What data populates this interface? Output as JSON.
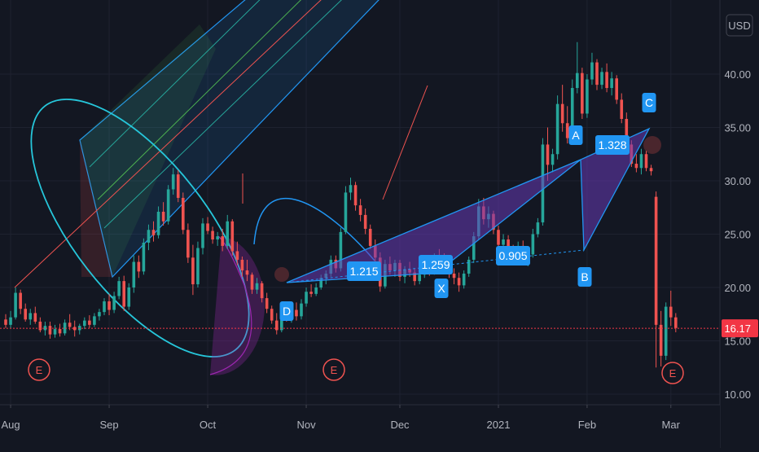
{
  "chart_data": {
    "type": "candlestick",
    "title": "",
    "currency": "USD",
    "last_price": "16.17",
    "y_axis_ticks": [
      "40.00",
      "35.00",
      "30.00",
      "25.00",
      "20.00",
      "15.00",
      "10.00"
    ],
    "x_axis_ticks": [
      "Aug",
      "Sep",
      "Oct",
      "Nov",
      "Dec",
      "2021",
      "Feb",
      "Mar"
    ],
    "ylim": [
      9.5,
      44
    ],
    "grid": true,
    "colors": {
      "up": "#26a69a",
      "down": "#ef5350",
      "price_line": "#f23645",
      "pattern_fill": "#673ab7",
      "pattern_line": "#2196f3",
      "label_bg": "#2196f3"
    },
    "candles": [
      [
        0,
        17.0,
        17.5,
        16.2,
        16.5
      ],
      [
        1,
        16.5,
        17.8,
        16.2,
        17.2
      ],
      [
        2,
        17.2,
        20.0,
        17.0,
        19.5
      ],
      [
        3,
        19.5,
        19.8,
        17.5,
        18.0
      ],
      [
        4,
        18.0,
        18.5,
        16.8,
        17.0
      ],
      [
        5,
        17.0,
        18.0,
        16.5,
        17.6
      ],
      [
        6,
        17.6,
        18.2,
        16.6,
        16.8
      ],
      [
        7,
        16.8,
        17.2,
        15.8,
        16.0
      ],
      [
        8,
        16.0,
        16.8,
        15.5,
        16.4
      ],
      [
        9,
        16.4,
        16.8,
        15.2,
        15.6
      ],
      [
        10,
        15.6,
        16.5,
        15.3,
        16.1
      ],
      [
        11,
        16.1,
        16.6,
        15.4,
        15.7
      ],
      [
        12,
        15.7,
        17.0,
        15.5,
        16.7
      ],
      [
        13,
        16.7,
        17.5,
        16.0,
        16.3
      ],
      [
        14,
        16.3,
        16.9,
        15.4,
        16.0
      ],
      [
        15,
        16.0,
        16.6,
        15.6,
        16.4
      ],
      [
        16,
        16.4,
        17.2,
        16.1,
        16.9
      ],
      [
        17,
        16.9,
        17.4,
        16.2,
        16.5
      ],
      [
        18,
        16.5,
        17.6,
        16.3,
        17.3
      ],
      [
        19,
        17.3,
        18.0,
        16.9,
        17.7
      ],
      [
        20,
        17.7,
        19.0,
        17.4,
        18.7
      ],
      [
        21,
        18.7,
        19.4,
        17.4,
        17.9
      ],
      [
        22,
        17.9,
        19.6,
        17.6,
        19.2
      ],
      [
        23,
        19.2,
        21.0,
        18.9,
        20.6
      ],
      [
        24,
        20.6,
        21.1,
        17.8,
        18.2
      ],
      [
        25,
        18.2,
        20.4,
        17.9,
        20.0
      ],
      [
        26,
        20.0,
        23.0,
        19.5,
        22.4
      ],
      [
        27,
        22.4,
        23.0,
        20.9,
        21.5
      ],
      [
        28,
        21.5,
        24.6,
        21.2,
        24.2
      ],
      [
        29,
        24.2,
        25.9,
        23.5,
        25.4
      ],
      [
        30,
        25.4,
        26.2,
        24.3,
        24.9
      ],
      [
        31,
        24.9,
        27.6,
        24.6,
        27.1
      ],
      [
        32,
        27.1,
        28.0,
        25.8,
        26.2
      ],
      [
        33,
        26.2,
        29.6,
        25.9,
        29.2
      ],
      [
        34,
        29.2,
        31.2,
        28.7,
        30.6
      ],
      [
        35,
        30.6,
        31.0,
        28.0,
        28.4
      ],
      [
        36,
        28.4,
        28.9,
        25.0,
        25.4
      ],
      [
        37,
        25.4,
        26.0,
        22.3,
        22.8
      ],
      [
        38,
        22.8,
        24.0,
        19.3,
        20.3
      ],
      [
        39,
        20.3,
        24.3,
        20.0,
        23.7
      ],
      [
        40,
        23.7,
        26.5,
        23.1,
        26.0
      ],
      [
        41,
        26.0,
        26.6,
        25.0,
        25.3
      ],
      [
        42,
        25.3,
        25.7,
        24.1,
        24.5
      ],
      [
        43,
        24.5,
        25.2,
        23.9,
        24.8
      ],
      [
        44,
        24.8,
        25.5,
        23.4,
        23.9
      ],
      [
        45,
        23.9,
        26.8,
        23.6,
        26.2
      ],
      [
        46,
        26.2,
        26.4,
        23.0,
        23.4
      ],
      [
        47,
        23.4,
        24.3,
        22.1,
        22.6
      ],
      [
        48,
        22.6,
        22.9,
        21.0,
        21.6
      ],
      [
        49,
        21.6,
        22.6,
        20.6,
        21.2
      ],
      [
        50,
        21.2,
        21.4,
        19.4,
        19.8
      ],
      [
        51,
        19.8,
        20.9,
        19.4,
        20.4
      ],
      [
        52,
        20.4,
        20.6,
        18.6,
        19.0
      ],
      [
        53,
        19.0,
        19.5,
        17.6,
        18.0
      ],
      [
        54,
        18.0,
        18.3,
        16.6,
        16.9
      ],
      [
        55,
        16.9,
        17.6,
        15.6,
        16.0
      ],
      [
        56,
        16.0,
        17.9,
        15.8,
        17.6
      ],
      [
        57,
        17.6,
        18.0,
        16.8,
        17.2
      ],
      [
        58,
        17.2,
        18.2,
        16.7,
        17.9
      ],
      [
        59,
        17.9,
        18.6,
        16.9,
        17.3
      ],
      [
        60,
        17.3,
        18.9,
        17.0,
        18.5
      ],
      [
        61,
        18.5,
        20.0,
        18.2,
        19.6
      ],
      [
        62,
        19.6,
        20.3,
        19.1,
        19.4
      ],
      [
        63,
        19.4,
        20.4,
        19.2,
        20.0
      ],
      [
        64,
        20.0,
        21.2,
        19.8,
        20.9
      ],
      [
        65,
        20.9,
        21.6,
        20.3,
        21.3
      ],
      [
        66,
        21.3,
        23.0,
        21.0,
        22.6
      ],
      [
        67,
        22.6,
        23.0,
        21.4,
        21.8
      ],
      [
        68,
        21.8,
        25.6,
        21.5,
        25.2
      ],
      [
        69,
        25.2,
        29.5,
        25.0,
        28.9
      ],
      [
        70,
        28.9,
        30.3,
        28.2,
        29.6
      ],
      [
        71,
        29.6,
        29.9,
        27.2,
        27.7
      ],
      [
        72,
        27.7,
        28.3,
        26.2,
        26.8
      ],
      [
        73,
        26.8,
        27.4,
        25.0,
        25.5
      ],
      [
        74,
        25.5,
        25.9,
        23.6,
        23.9
      ],
      [
        75,
        23.9,
        24.5,
        22.4,
        22.8
      ],
      [
        76,
        22.8,
        23.3,
        19.6,
        20.1
      ],
      [
        77,
        20.1,
        22.6,
        19.9,
        22.2
      ],
      [
        78,
        22.2,
        22.9,
        21.2,
        21.6
      ],
      [
        79,
        21.6,
        22.6,
        21.0,
        22.3
      ],
      [
        80,
        22.3,
        22.6,
        20.6,
        21.0
      ],
      [
        81,
        21.0,
        22.0,
        20.4,
        21.7
      ],
      [
        82,
        21.7,
        22.4,
        21.0,
        21.4
      ],
      [
        83,
        21.4,
        21.8,
        20.2,
        20.6
      ],
      [
        84,
        20.6,
        21.6,
        20.3,
        21.2
      ],
      [
        85,
        21.2,
        22.4,
        20.9,
        22.0
      ],
      [
        86,
        22.0,
        22.5,
        21.1,
        21.5
      ],
      [
        87,
        21.5,
        23.2,
        21.2,
        22.9
      ],
      [
        88,
        22.9,
        23.6,
        22.1,
        22.6
      ],
      [
        89,
        22.6,
        23.2,
        21.6,
        22.0
      ],
      [
        90,
        22.0,
        22.3,
        20.9,
        21.3
      ],
      [
        91,
        21.3,
        21.8,
        20.3,
        20.9
      ],
      [
        92,
        20.9,
        21.4,
        19.6,
        20.2
      ],
      [
        93,
        20.2,
        21.6,
        19.9,
        21.3
      ],
      [
        94,
        21.3,
        22.9,
        21.0,
        22.6
      ],
      [
        95,
        22.6,
        25.2,
        22.3,
        24.8
      ],
      [
        96,
        24.8,
        28.3,
        24.5,
        27.6
      ],
      [
        97,
        27.6,
        28.4,
        25.9,
        26.4
      ],
      [
        98,
        26.4,
        27.6,
        25.6,
        26.9
      ],
      [
        99,
        26.9,
        27.2,
        25.0,
        25.4
      ],
      [
        100,
        25.4,
        25.8,
        23.6,
        24.0
      ],
      [
        101,
        24.0,
        25.0,
        23.3,
        24.5
      ],
      [
        102,
        24.5,
        24.9,
        23.1,
        23.5
      ],
      [
        103,
        23.5,
        24.0,
        22.6,
        23.0
      ],
      [
        104,
        23.0,
        24.3,
        22.7,
        23.9
      ],
      [
        105,
        23.9,
        24.4,
        22.3,
        22.7
      ],
      [
        106,
        22.7,
        23.4,
        22.0,
        23.1
      ],
      [
        107,
        23.1,
        25.5,
        22.8,
        25.0
      ],
      [
        108,
        25.0,
        26.5,
        24.7,
        26.1
      ],
      [
        109,
        26.1,
        34.0,
        25.8,
        33.4
      ],
      [
        110,
        33.4,
        35.0,
        30.0,
        31.5
      ],
      [
        111,
        31.5,
        33.0,
        30.8,
        32.5
      ],
      [
        112,
        32.5,
        38.0,
        32.0,
        37.2
      ],
      [
        113,
        37.2,
        39.0,
        34.6,
        35.4
      ],
      [
        114,
        35.4,
        37.0,
        33.5,
        34.0
      ],
      [
        115,
        34.0,
        39.5,
        33.6,
        38.7
      ],
      [
        116,
        38.7,
        43.0,
        38.2,
        40.1
      ],
      [
        117,
        40.1,
        40.6,
        35.8,
        36.3
      ],
      [
        118,
        36.3,
        40.0,
        35.9,
        39.5
      ],
      [
        119,
        39.5,
        42.0,
        39.0,
        41.1
      ],
      [
        120,
        41.1,
        41.4,
        38.5,
        39.0
      ],
      [
        121,
        39.0,
        40.6,
        38.6,
        40.2
      ],
      [
        122,
        40.2,
        41.0,
        38.3,
        38.7
      ],
      [
        123,
        38.7,
        40.2,
        38.0,
        39.6
      ],
      [
        124,
        39.6,
        39.9,
        37.2,
        37.6
      ],
      [
        125,
        37.6,
        38.2,
        35.4,
        35.8
      ],
      [
        126,
        35.8,
        36.4,
        32.9,
        33.4
      ],
      [
        127,
        33.4,
        33.8,
        31.3,
        31.6
      ],
      [
        128,
        31.6,
        32.5,
        30.8,
        31.2
      ],
      [
        129,
        31.2,
        33.0,
        30.6,
        32.5
      ],
      [
        130,
        32.5,
        32.8,
        30.9,
        31.2
      ],
      [
        131,
        31.2,
        31.5,
        30.5,
        30.9
      ],
      [
        132,
        28.5,
        29.0,
        12.5,
        16.5
      ],
      [
        133,
        16.5,
        17.8,
        12.6,
        13.6
      ],
      [
        134,
        13.6,
        18.6,
        13.2,
        18.2
      ],
      [
        135,
        18.2,
        19.7,
        16.4,
        17.2
      ],
      [
        136,
        17.2,
        17.6,
        15.8,
        16.2
      ]
    ],
    "projections": {
      "volume_ruler": "top-left",
      "harmonic_pattern": "XABCD"
    },
    "annotations": {
      "pattern_labels": [
        "D",
        "X",
        "A",
        "B",
        "C"
      ],
      "ratio_labels": [
        "1.215",
        "1.259",
        "0.905",
        "1.328"
      ],
      "earnings_markers": [
        "E",
        "E",
        "E"
      ]
    }
  }
}
